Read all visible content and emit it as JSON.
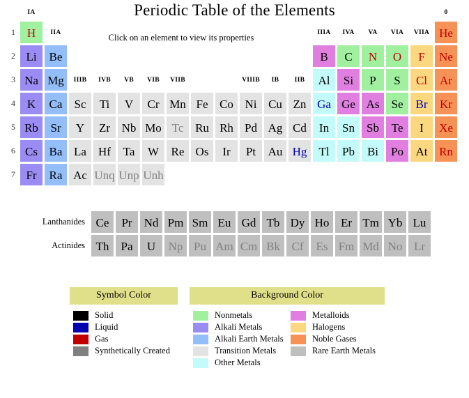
{
  "page": {
    "title": "Periodic Table of the Elements",
    "hint": "Click on an element to view its properties"
  },
  "colors": {
    "nonmetals": "#a0f0a0",
    "alkali_metals": "#9b8cf5",
    "alkali_earth_metals": "#93befa",
    "transition_metals": "#e3e3e3",
    "other_metals": "#c3fafa",
    "metalloids": "#e07fe0",
    "halogens": "#fbd77f",
    "noble_gases": "#f79256",
    "rare_earth_metals": "#bfbfbf",
    "solid": "#000000",
    "liquid": "#0000b0",
    "gas": "#c00000",
    "synthetic": "#808080",
    "legend_header_bg": "#e1e08a"
  },
  "table": {
    "row_labels": [
      "1",
      "2",
      "3",
      "4",
      "5",
      "6",
      "7"
    ],
    "group_labels_top": [
      {
        "label": "IA",
        "col": 1
      },
      {
        "label": "IIA",
        "col": 2
      },
      {
        "label": "IIIA",
        "col": 13
      },
      {
        "label": "IVA",
        "col": 14
      },
      {
        "label": "VA",
        "col": 15
      },
      {
        "label": "VIA",
        "col": 16
      },
      {
        "label": "VIIA",
        "col": 17
      },
      {
        "label": "0",
        "col": 18
      }
    ],
    "group_labels_mid": [
      {
        "label": "IIIB",
        "col": 3
      },
      {
        "label": "IVB",
        "col": 4
      },
      {
        "label": "VB",
        "col": 5
      },
      {
        "label": "VIB",
        "col": 6
      },
      {
        "label": "VIIB",
        "col": 7
      },
      {
        "label": "VIIIB",
        "col": 10
      },
      {
        "label": "IB",
        "col": 11
      },
      {
        "label": "IIB",
        "col": 12
      }
    ],
    "elements": [
      {
        "s": "H",
        "r": 1,
        "c": 1,
        "bg": "nonmetals",
        "fg": "gas"
      },
      {
        "s": "He",
        "r": 1,
        "c": 18,
        "bg": "noble_gases",
        "fg": "gas"
      },
      {
        "s": "Li",
        "r": 2,
        "c": 1,
        "bg": "alkali_metals",
        "fg": "solid"
      },
      {
        "s": "Be",
        "r": 2,
        "c": 2,
        "bg": "alkali_earth_metals",
        "fg": "solid"
      },
      {
        "s": "B",
        "r": 2,
        "c": 13,
        "bg": "metalloids",
        "fg": "solid"
      },
      {
        "s": "C",
        "r": 2,
        "c": 14,
        "bg": "nonmetals",
        "fg": "solid"
      },
      {
        "s": "N",
        "r": 2,
        "c": 15,
        "bg": "nonmetals",
        "fg": "gas"
      },
      {
        "s": "O",
        "r": 2,
        "c": 16,
        "bg": "nonmetals",
        "fg": "gas"
      },
      {
        "s": "F",
        "r": 2,
        "c": 17,
        "bg": "halogens",
        "fg": "gas"
      },
      {
        "s": "Ne",
        "r": 2,
        "c": 18,
        "bg": "noble_gases",
        "fg": "gas"
      },
      {
        "s": "Na",
        "r": 3,
        "c": 1,
        "bg": "alkali_metals",
        "fg": "solid"
      },
      {
        "s": "Mg",
        "r": 3,
        "c": 2,
        "bg": "alkali_earth_metals",
        "fg": "solid"
      },
      {
        "s": "Al",
        "r": 3,
        "c": 13,
        "bg": "other_metals",
        "fg": "solid"
      },
      {
        "s": "Si",
        "r": 3,
        "c": 14,
        "bg": "metalloids",
        "fg": "solid"
      },
      {
        "s": "P",
        "r": 3,
        "c": 15,
        "bg": "nonmetals",
        "fg": "solid"
      },
      {
        "s": "S",
        "r": 3,
        "c": 16,
        "bg": "nonmetals",
        "fg": "solid"
      },
      {
        "s": "Cl",
        "r": 3,
        "c": 17,
        "bg": "halogens",
        "fg": "gas"
      },
      {
        "s": "Ar",
        "r": 3,
        "c": 18,
        "bg": "noble_gases",
        "fg": "gas"
      },
      {
        "s": "K",
        "r": 4,
        "c": 1,
        "bg": "alkali_metals",
        "fg": "solid"
      },
      {
        "s": "Ca",
        "r": 4,
        "c": 2,
        "bg": "alkali_earth_metals",
        "fg": "solid"
      },
      {
        "s": "Sc",
        "r": 4,
        "c": 3,
        "bg": "transition_metals",
        "fg": "solid"
      },
      {
        "s": "Ti",
        "r": 4,
        "c": 4,
        "bg": "transition_metals",
        "fg": "solid"
      },
      {
        "s": "V",
        "r": 4,
        "c": 5,
        "bg": "transition_metals",
        "fg": "solid"
      },
      {
        "s": "Cr",
        "r": 4,
        "c": 6,
        "bg": "transition_metals",
        "fg": "solid"
      },
      {
        "s": "Mn",
        "r": 4,
        "c": 7,
        "bg": "transition_metals",
        "fg": "solid"
      },
      {
        "s": "Fe",
        "r": 4,
        "c": 8,
        "bg": "transition_metals",
        "fg": "solid"
      },
      {
        "s": "Co",
        "r": 4,
        "c": 9,
        "bg": "transition_metals",
        "fg": "solid"
      },
      {
        "s": "Ni",
        "r": 4,
        "c": 10,
        "bg": "transition_metals",
        "fg": "solid"
      },
      {
        "s": "Cu",
        "r": 4,
        "c": 11,
        "bg": "transition_metals",
        "fg": "solid"
      },
      {
        "s": "Zn",
        "r": 4,
        "c": 12,
        "bg": "transition_metals",
        "fg": "solid"
      },
      {
        "s": "Ga",
        "r": 4,
        "c": 13,
        "bg": "other_metals",
        "fg": "liquid"
      },
      {
        "s": "Ge",
        "r": 4,
        "c": 14,
        "bg": "metalloids",
        "fg": "solid"
      },
      {
        "s": "As",
        "r": 4,
        "c": 15,
        "bg": "metalloids",
        "fg": "solid"
      },
      {
        "s": "Se",
        "r": 4,
        "c": 16,
        "bg": "nonmetals",
        "fg": "solid"
      },
      {
        "s": "Br",
        "r": 4,
        "c": 17,
        "bg": "halogens",
        "fg": "liquid"
      },
      {
        "s": "Kr",
        "r": 4,
        "c": 18,
        "bg": "noble_gases",
        "fg": "gas"
      },
      {
        "s": "Rb",
        "r": 5,
        "c": 1,
        "bg": "alkali_metals",
        "fg": "solid"
      },
      {
        "s": "Sr",
        "r": 5,
        "c": 2,
        "bg": "alkali_earth_metals",
        "fg": "solid"
      },
      {
        "s": "Y",
        "r": 5,
        "c": 3,
        "bg": "transition_metals",
        "fg": "solid"
      },
      {
        "s": "Zr",
        "r": 5,
        "c": 4,
        "bg": "transition_metals",
        "fg": "solid"
      },
      {
        "s": "Nb",
        "r": 5,
        "c": 5,
        "bg": "transition_metals",
        "fg": "solid"
      },
      {
        "s": "Mo",
        "r": 5,
        "c": 6,
        "bg": "transition_metals",
        "fg": "solid"
      },
      {
        "s": "Tc",
        "r": 5,
        "c": 7,
        "bg": "transition_metals",
        "fg": "synthetic"
      },
      {
        "s": "Ru",
        "r": 5,
        "c": 8,
        "bg": "transition_metals",
        "fg": "solid"
      },
      {
        "s": "Rh",
        "r": 5,
        "c": 9,
        "bg": "transition_metals",
        "fg": "solid"
      },
      {
        "s": "Pd",
        "r": 5,
        "c": 10,
        "bg": "transition_metals",
        "fg": "solid"
      },
      {
        "s": "Ag",
        "r": 5,
        "c": 11,
        "bg": "transition_metals",
        "fg": "solid"
      },
      {
        "s": "Cd",
        "r": 5,
        "c": 12,
        "bg": "transition_metals",
        "fg": "solid"
      },
      {
        "s": "In",
        "r": 5,
        "c": 13,
        "bg": "other_metals",
        "fg": "solid"
      },
      {
        "s": "Sn",
        "r": 5,
        "c": 14,
        "bg": "other_metals",
        "fg": "solid"
      },
      {
        "s": "Sb",
        "r": 5,
        "c": 15,
        "bg": "metalloids",
        "fg": "solid"
      },
      {
        "s": "Te",
        "r": 5,
        "c": 16,
        "bg": "metalloids",
        "fg": "solid"
      },
      {
        "s": "I",
        "r": 5,
        "c": 17,
        "bg": "halogens",
        "fg": "solid"
      },
      {
        "s": "Xe",
        "r": 5,
        "c": 18,
        "bg": "noble_gases",
        "fg": "gas"
      },
      {
        "s": "Cs",
        "r": 6,
        "c": 1,
        "bg": "alkali_metals",
        "fg": "solid"
      },
      {
        "s": "Ba",
        "r": 6,
        "c": 2,
        "bg": "alkali_earth_metals",
        "fg": "solid"
      },
      {
        "s": "La",
        "r": 6,
        "c": 3,
        "bg": "transition_metals",
        "fg": "solid"
      },
      {
        "s": "Hf",
        "r": 6,
        "c": 4,
        "bg": "transition_metals",
        "fg": "solid"
      },
      {
        "s": "Ta",
        "r": 6,
        "c": 5,
        "bg": "transition_metals",
        "fg": "solid"
      },
      {
        "s": "W",
        "r": 6,
        "c": 6,
        "bg": "transition_metals",
        "fg": "solid"
      },
      {
        "s": "Re",
        "r": 6,
        "c": 7,
        "bg": "transition_metals",
        "fg": "solid"
      },
      {
        "s": "Os",
        "r": 6,
        "c": 8,
        "bg": "transition_metals",
        "fg": "solid"
      },
      {
        "s": "Ir",
        "r": 6,
        "c": 9,
        "bg": "transition_metals",
        "fg": "solid"
      },
      {
        "s": "Pt",
        "r": 6,
        "c": 10,
        "bg": "transition_metals",
        "fg": "solid"
      },
      {
        "s": "Au",
        "r": 6,
        "c": 11,
        "bg": "transition_metals",
        "fg": "solid"
      },
      {
        "s": "Hg",
        "r": 6,
        "c": 12,
        "bg": "transition_metals",
        "fg": "liquid"
      },
      {
        "s": "Tl",
        "r": 6,
        "c": 13,
        "bg": "other_metals",
        "fg": "solid"
      },
      {
        "s": "Pb",
        "r": 6,
        "c": 14,
        "bg": "other_metals",
        "fg": "solid"
      },
      {
        "s": "Bi",
        "r": 6,
        "c": 15,
        "bg": "other_metals",
        "fg": "solid"
      },
      {
        "s": "Po",
        "r": 6,
        "c": 16,
        "bg": "metalloids",
        "fg": "solid"
      },
      {
        "s": "At",
        "r": 6,
        "c": 17,
        "bg": "halogens",
        "fg": "solid"
      },
      {
        "s": "Rn",
        "r": 6,
        "c": 18,
        "bg": "noble_gases",
        "fg": "gas"
      },
      {
        "s": "Fr",
        "r": 7,
        "c": 1,
        "bg": "alkali_metals",
        "fg": "solid"
      },
      {
        "s": "Ra",
        "r": 7,
        "c": 2,
        "bg": "alkali_earth_metals",
        "fg": "solid"
      },
      {
        "s": "Ac",
        "r": 7,
        "c": 3,
        "bg": "transition_metals",
        "fg": "solid"
      },
      {
        "s": "Unq",
        "r": 7,
        "c": 4,
        "bg": "transition_metals",
        "fg": "synthetic"
      },
      {
        "s": "Unp",
        "r": 7,
        "c": 5,
        "bg": "transition_metals",
        "fg": "synthetic"
      },
      {
        "s": "Unh",
        "r": 7,
        "c": 6,
        "bg": "transition_metals",
        "fg": "synthetic"
      }
    ]
  },
  "fblock": {
    "lanthanides_label": "Lanthanides",
    "actinides_label": "Actinides",
    "lanthanides": [
      {
        "s": "Ce",
        "fg": "solid"
      },
      {
        "s": "Pr",
        "fg": "solid"
      },
      {
        "s": "Nd",
        "fg": "solid"
      },
      {
        "s": "Pm",
        "fg": "solid"
      },
      {
        "s": "Sm",
        "fg": "solid"
      },
      {
        "s": "Eu",
        "fg": "solid"
      },
      {
        "s": "Gd",
        "fg": "solid"
      },
      {
        "s": "Tb",
        "fg": "solid"
      },
      {
        "s": "Dy",
        "fg": "solid"
      },
      {
        "s": "Ho",
        "fg": "solid"
      },
      {
        "s": "Er",
        "fg": "solid"
      },
      {
        "s": "Tm",
        "fg": "solid"
      },
      {
        "s": "Yb",
        "fg": "solid"
      },
      {
        "s": "Lu",
        "fg": "solid"
      }
    ],
    "actinides": [
      {
        "s": "Th",
        "fg": "solid"
      },
      {
        "s": "Pa",
        "fg": "solid"
      },
      {
        "s": "U",
        "fg": "solid"
      },
      {
        "s": "Np",
        "fg": "synthetic"
      },
      {
        "s": "Pu",
        "fg": "synthetic"
      },
      {
        "s": "Am",
        "fg": "synthetic"
      },
      {
        "s": "Cm",
        "fg": "synthetic"
      },
      {
        "s": "Bk",
        "fg": "synthetic"
      },
      {
        "s": "Cf",
        "fg": "synthetic"
      },
      {
        "s": "Es",
        "fg": "synthetic"
      },
      {
        "s": "Fm",
        "fg": "synthetic"
      },
      {
        "s": "Md",
        "fg": "synthetic"
      },
      {
        "s": "No",
        "fg": "synthetic"
      },
      {
        "s": "Lr",
        "fg": "synthetic"
      }
    ]
  },
  "legend": {
    "symbol_color": {
      "header": "Symbol Color",
      "items": [
        {
          "label": "Solid",
          "key": "solid"
        },
        {
          "label": "Liquid",
          "key": "liquid"
        },
        {
          "label": "Gas",
          "key": "gas"
        },
        {
          "label": "Synthetically Created",
          "key": "synthetic"
        }
      ]
    },
    "background_color": {
      "header": "Background Color",
      "col1": [
        {
          "label": "Nonmetals",
          "key": "nonmetals"
        },
        {
          "label": "Alkali Metals",
          "key": "alkali_metals"
        },
        {
          "label": "Alkali Earth Metals",
          "key": "alkali_earth_metals"
        },
        {
          "label": "Transition Metals",
          "key": "transition_metals"
        },
        {
          "label": "Other Metals",
          "key": "other_metals"
        }
      ],
      "col2": [
        {
          "label": "Metalloids",
          "key": "metalloids"
        },
        {
          "label": "Halogens",
          "key": "halogens"
        },
        {
          "label": "Noble Gases",
          "key": "noble_gases"
        },
        {
          "label": "Rare Earth Metals",
          "key": "rare_earth_metals"
        }
      ]
    }
  }
}
